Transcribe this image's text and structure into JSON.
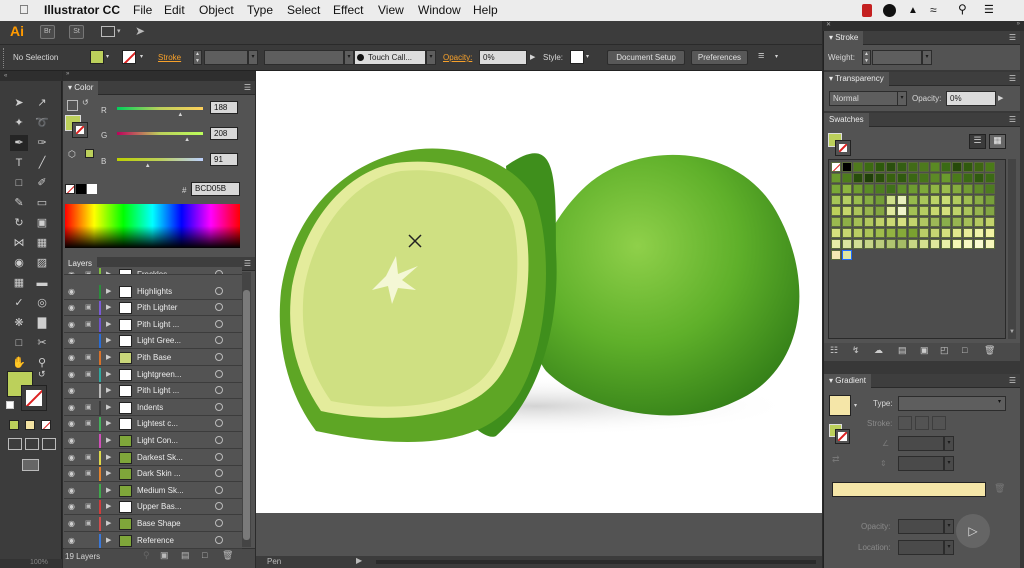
{
  "menubar": {
    "apple": "",
    "app": "Illustrator CC",
    "items": [
      "File",
      "Edit",
      "Object",
      "Type",
      "Select",
      "Effect",
      "View",
      "Window",
      "Help"
    ]
  },
  "appbar": {
    "logo": "Ai",
    "br": "Br",
    "st": "St"
  },
  "control": {
    "selection": "No Selection",
    "stroke_label": "Stroke",
    "brush": "Touch Call...",
    "opacity_label": "Opacity:",
    "opacity_value": "0%",
    "style_label": "Style:",
    "document_setup": "Document Setup",
    "preferences": "Preferences"
  },
  "color_panel": {
    "title": "Color",
    "r_label": "R",
    "g_label": "G",
    "b_label": "B",
    "r": "188",
    "g": "208",
    "b": "91",
    "r_frac": 0.737,
    "g_frac": 0.816,
    "b_frac": 0.357,
    "hex_label": "#",
    "hex": "BCD05B",
    "fill_color": "#bcd05b"
  },
  "layers_panel": {
    "title": "Layers",
    "count": "19 Layers",
    "rows": [
      {
        "name": "Freckles",
        "color": "#7fbf3f"
      },
      {
        "name": "Highlights",
        "color": "#2c8c3c"
      },
      {
        "name": "Pith Lighter",
        "color": "#7b5bd6"
      },
      {
        "name": "Pith Light ...",
        "color": "#6f52d0"
      },
      {
        "name": "Light Gree...",
        "color": "#2a6cd4"
      },
      {
        "name": "Pith Base",
        "color": "#d8722a"
      },
      {
        "name": "Lightgreen...",
        "color": "#2fa8a0"
      },
      {
        "name": "Pith Light ...",
        "color": "#b8b8b8"
      },
      {
        "name": "Indents",
        "color": "#3b3b3b"
      },
      {
        "name": "Lightest c...",
        "color": "#44b05b"
      },
      {
        "name": "Light Con...",
        "color": "#d04fb9"
      },
      {
        "name": "Darkest Sk...",
        "color": "#ded94a"
      },
      {
        "name": "Dark Skin ...",
        "color": "#e6842c"
      },
      {
        "name": "Medium Sk...",
        "color": "#3fa84b"
      },
      {
        "name": "Upper Bas...",
        "color": "#d03c3c"
      },
      {
        "name": "Base Shape",
        "color": "#d24d4d"
      },
      {
        "name": "Reference",
        "color": "#3a78d8"
      }
    ]
  },
  "stroke_panel": {
    "title": "Stroke",
    "weight_label": "Weight:"
  },
  "transparency_panel": {
    "title": "Transparency",
    "mode": "Normal",
    "opacity_label": "Opacity:",
    "opacity": "0%"
  },
  "swatches_panel": {
    "title": "Swatches"
  },
  "gradient_panel": {
    "title": "Gradient",
    "type_label": "Type:",
    "stroke_label": "Stroke:",
    "opacity_label": "Opacity:",
    "location_label": "Location:",
    "gradient_color": "#f5e6a8"
  },
  "status": {
    "zoom": "100%",
    "tool": "Pen"
  }
}
